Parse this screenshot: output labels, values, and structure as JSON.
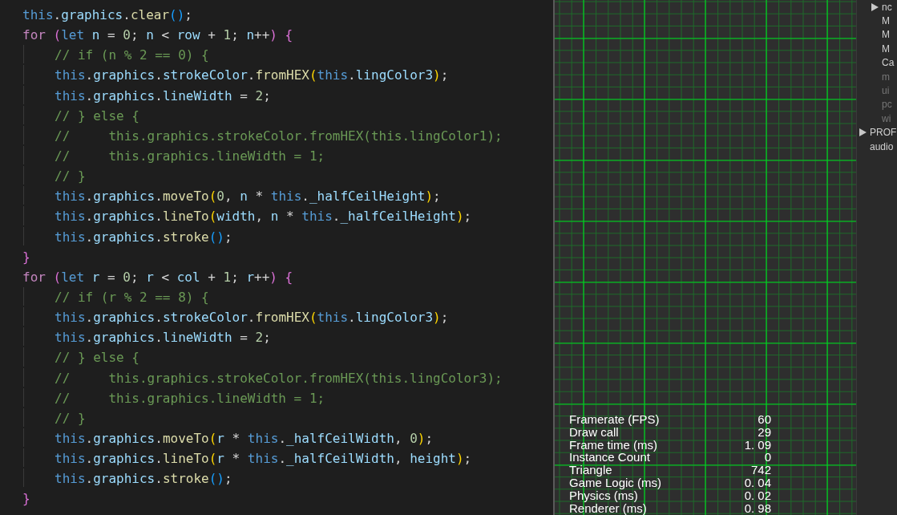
{
  "editor": {
    "lines": [
      {
        "tokens": [
          {
            "kind": "this",
            "text": "this"
          },
          {
            "kind": "punc",
            "text": "."
          },
          {
            "kind": "prop",
            "text": "graphics"
          },
          {
            "kind": "punc",
            "text": "."
          },
          {
            "kind": "fn",
            "text": "clear"
          },
          {
            "kind": "b3",
            "text": "()"
          },
          {
            "kind": "punc",
            "text": ";"
          }
        ]
      },
      {
        "tokens": [
          {
            "kind": "kw",
            "text": "for"
          },
          {
            "kind": "b1",
            "text": " ("
          },
          {
            "kind": "kw2",
            "text": "let"
          },
          {
            "kind": "prop",
            "text": " n"
          },
          {
            "kind": "punc",
            "text": " = "
          },
          {
            "kind": "num",
            "text": "0"
          },
          {
            "kind": "punc",
            "text": "; "
          },
          {
            "kind": "prop",
            "text": "n"
          },
          {
            "kind": "punc",
            "text": " < "
          },
          {
            "kind": "prop",
            "text": "row"
          },
          {
            "kind": "punc",
            "text": " + "
          },
          {
            "kind": "num",
            "text": "1"
          },
          {
            "kind": "punc",
            "text": "; "
          },
          {
            "kind": "prop",
            "text": "n"
          },
          {
            "kind": "punc",
            "text": "++"
          },
          {
            "kind": "b1",
            "text": ")"
          },
          {
            "kind": "b1",
            "text": " {"
          }
        ],
        "children": [
          {
            "tokens": [
              {
                "kind": "cmt",
                "text": "// if (n % 2 == 0) {"
              }
            ]
          },
          {
            "tokens": [
              {
                "kind": "this",
                "text": "this"
              },
              {
                "kind": "punc",
                "text": "."
              },
              {
                "kind": "prop",
                "text": "graphics"
              },
              {
                "kind": "punc",
                "text": "."
              },
              {
                "kind": "prop",
                "text": "strokeColor"
              },
              {
                "kind": "punc",
                "text": "."
              },
              {
                "kind": "fn",
                "text": "fromHEX"
              },
              {
                "kind": "b2",
                "text": "("
              },
              {
                "kind": "this",
                "text": "this"
              },
              {
                "kind": "punc",
                "text": "."
              },
              {
                "kind": "prop",
                "text": "lingColor3"
              },
              {
                "kind": "b2",
                "text": ")"
              },
              {
                "kind": "punc",
                "text": ";"
              }
            ]
          },
          {
            "tokens": [
              {
                "kind": "this",
                "text": "this"
              },
              {
                "kind": "punc",
                "text": "."
              },
              {
                "kind": "prop",
                "text": "graphics"
              },
              {
                "kind": "punc",
                "text": "."
              },
              {
                "kind": "prop",
                "text": "lineWidth"
              },
              {
                "kind": "punc",
                "text": " = "
              },
              {
                "kind": "num",
                "text": "2"
              },
              {
                "kind": "punc",
                "text": ";"
              }
            ]
          },
          {
            "tokens": [
              {
                "kind": "cmt",
                "text": "// } else {"
              }
            ]
          },
          {
            "tokens": [
              {
                "kind": "cmt",
                "text": "//     this.graphics.strokeColor.fromHEX(this.lingColor1);"
              }
            ]
          },
          {
            "tokens": [
              {
                "kind": "cmt",
                "text": "//     this.graphics.lineWidth = 1;"
              }
            ]
          },
          {
            "tokens": [
              {
                "kind": "cmt",
                "text": "// }"
              }
            ]
          },
          {
            "tokens": [
              {
                "kind": "this",
                "text": "this"
              },
              {
                "kind": "punc",
                "text": "."
              },
              {
                "kind": "prop",
                "text": "graphics"
              },
              {
                "kind": "punc",
                "text": "."
              },
              {
                "kind": "fn",
                "text": "moveTo"
              },
              {
                "kind": "b2",
                "text": "("
              },
              {
                "kind": "num",
                "text": "0"
              },
              {
                "kind": "punc",
                "text": ", "
              },
              {
                "kind": "prop",
                "text": "n"
              },
              {
                "kind": "punc",
                "text": " * "
              },
              {
                "kind": "this",
                "text": "this"
              },
              {
                "kind": "punc",
                "text": "."
              },
              {
                "kind": "prop",
                "text": "_halfCeilHeight"
              },
              {
                "kind": "b2",
                "text": ")"
              },
              {
                "kind": "punc",
                "text": ";"
              }
            ]
          },
          {
            "tokens": [
              {
                "kind": "this",
                "text": "this"
              },
              {
                "kind": "punc",
                "text": "."
              },
              {
                "kind": "prop",
                "text": "graphics"
              },
              {
                "kind": "punc",
                "text": "."
              },
              {
                "kind": "fn",
                "text": "lineTo"
              },
              {
                "kind": "b2",
                "text": "("
              },
              {
                "kind": "prop",
                "text": "width"
              },
              {
                "kind": "punc",
                "text": ", "
              },
              {
                "kind": "prop",
                "text": "n"
              },
              {
                "kind": "punc",
                "text": " * "
              },
              {
                "kind": "this",
                "text": "this"
              },
              {
                "kind": "punc",
                "text": "."
              },
              {
                "kind": "prop",
                "text": "_halfCeilHeight"
              },
              {
                "kind": "b2",
                "text": ")"
              },
              {
                "kind": "punc",
                "text": ";"
              }
            ]
          },
          {
            "tokens": [
              {
                "kind": "this",
                "text": "this"
              },
              {
                "kind": "punc",
                "text": "."
              },
              {
                "kind": "prop",
                "text": "graphics"
              },
              {
                "kind": "punc",
                "text": "."
              },
              {
                "kind": "fn",
                "text": "stroke"
              },
              {
                "kind": "b3",
                "text": "()"
              },
              {
                "kind": "punc",
                "text": ";"
              }
            ]
          }
        ]
      },
      {
        "tokens": [
          {
            "kind": "b1",
            "text": "}"
          }
        ]
      },
      {
        "tokens": [
          {
            "kind": "kw",
            "text": "for"
          },
          {
            "kind": "b1",
            "text": " ("
          },
          {
            "kind": "kw2",
            "text": "let"
          },
          {
            "kind": "prop",
            "text": " r"
          },
          {
            "kind": "punc",
            "text": " = "
          },
          {
            "kind": "num",
            "text": "0"
          },
          {
            "kind": "punc",
            "text": "; "
          },
          {
            "kind": "prop",
            "text": "r"
          },
          {
            "kind": "punc",
            "text": " < "
          },
          {
            "kind": "prop",
            "text": "col"
          },
          {
            "kind": "punc",
            "text": " + "
          },
          {
            "kind": "num",
            "text": "1"
          },
          {
            "kind": "punc",
            "text": "; "
          },
          {
            "kind": "prop",
            "text": "r"
          },
          {
            "kind": "punc",
            "text": "++"
          },
          {
            "kind": "b1",
            "text": ")"
          },
          {
            "kind": "b1",
            "text": " {"
          }
        ],
        "children": [
          {
            "tokens": [
              {
                "kind": "cmt",
                "text": "// if (r % 2 == 8) {"
              }
            ]
          },
          {
            "tokens": [
              {
                "kind": "this",
                "text": "this"
              },
              {
                "kind": "punc",
                "text": "."
              },
              {
                "kind": "prop",
                "text": "graphics"
              },
              {
                "kind": "punc",
                "text": "."
              },
              {
                "kind": "prop",
                "text": "strokeColor"
              },
              {
                "kind": "punc",
                "text": "."
              },
              {
                "kind": "fn",
                "text": "fromHEX"
              },
              {
                "kind": "b2",
                "text": "("
              },
              {
                "kind": "this",
                "text": "this"
              },
              {
                "kind": "punc",
                "text": "."
              },
              {
                "kind": "prop",
                "text": "lingColor3"
              },
              {
                "kind": "b2",
                "text": ")"
              },
              {
                "kind": "punc",
                "text": ";"
              }
            ]
          },
          {
            "tokens": [
              {
                "kind": "this",
                "text": "this"
              },
              {
                "kind": "punc",
                "text": "."
              },
              {
                "kind": "prop",
                "text": "graphics"
              },
              {
                "kind": "punc",
                "text": "."
              },
              {
                "kind": "prop",
                "text": "lineWidth"
              },
              {
                "kind": "punc",
                "text": " = "
              },
              {
                "kind": "num",
                "text": "2"
              },
              {
                "kind": "punc",
                "text": ";"
              }
            ]
          },
          {
            "tokens": [
              {
                "kind": "cmt",
                "text": "// } else {"
              }
            ]
          },
          {
            "tokens": [
              {
                "kind": "cmt",
                "text": "//     this.graphics.strokeColor.fromHEX(this.lingColor3);"
              }
            ]
          },
          {
            "tokens": [
              {
                "kind": "cmt",
                "text": "//     this.graphics.lineWidth = 1;"
              }
            ]
          },
          {
            "tokens": [
              {
                "kind": "cmt",
                "text": "// }"
              }
            ]
          },
          {
            "tokens": [
              {
                "kind": "this",
                "text": "this"
              },
              {
                "kind": "punc",
                "text": "."
              },
              {
                "kind": "prop",
                "text": "graphics"
              },
              {
                "kind": "punc",
                "text": "."
              },
              {
                "kind": "fn",
                "text": "moveTo"
              },
              {
                "kind": "b2",
                "text": "("
              },
              {
                "kind": "prop",
                "text": "r"
              },
              {
                "kind": "punc",
                "text": " * "
              },
              {
                "kind": "this",
                "text": "this"
              },
              {
                "kind": "punc",
                "text": "."
              },
              {
                "kind": "prop",
                "text": "_halfCeilWidth"
              },
              {
                "kind": "punc",
                "text": ", "
              },
              {
                "kind": "num",
                "text": "0"
              },
              {
                "kind": "b2",
                "text": ")"
              },
              {
                "kind": "punc",
                "text": ";"
              }
            ]
          },
          {
            "tokens": [
              {
                "kind": "this",
                "text": "this"
              },
              {
                "kind": "punc",
                "text": "."
              },
              {
                "kind": "prop",
                "text": "graphics"
              },
              {
                "kind": "punc",
                "text": "."
              },
              {
                "kind": "fn",
                "text": "lineTo"
              },
              {
                "kind": "b2",
                "text": "("
              },
              {
                "kind": "prop",
                "text": "r"
              },
              {
                "kind": "punc",
                "text": " * "
              },
              {
                "kind": "this",
                "text": "this"
              },
              {
                "kind": "punc",
                "text": "."
              },
              {
                "kind": "prop",
                "text": "_halfCeilWidth"
              },
              {
                "kind": "punc",
                "text": ", "
              },
              {
                "kind": "prop",
                "text": "height"
              },
              {
                "kind": "b2",
                "text": ")"
              },
              {
                "kind": "punc",
                "text": ";"
              }
            ]
          },
          {
            "tokens": [
              {
                "kind": "this",
                "text": "this"
              },
              {
                "kind": "punc",
                "text": "."
              },
              {
                "kind": "prop",
                "text": "graphics"
              },
              {
                "kind": "punc",
                "text": "."
              },
              {
                "kind": "fn",
                "text": "stroke"
              },
              {
                "kind": "b3",
                "text": "()"
              },
              {
                "kind": "punc",
                "text": ";"
              }
            ]
          }
        ]
      },
      {
        "tokens": [
          {
            "kind": "b1",
            "text": "}"
          }
        ]
      }
    ]
  },
  "stats": [
    {
      "label": "Framerate (FPS)",
      "value": "60"
    },
    {
      "label": "Draw call",
      "value": "29"
    },
    {
      "label": "Frame time (ms)",
      "value": "1. 09"
    },
    {
      "label": "Instance Count",
      "value": "0"
    },
    {
      "label": "Triangle",
      "value": "742"
    },
    {
      "label": "Game Logic (ms)",
      "value": "0. 04"
    },
    {
      "label": "Physics (ms)",
      "value": "0. 02"
    },
    {
      "label": "Renderer (ms)",
      "value": "0. 98"
    }
  ],
  "hierarchy": {
    "inner_items": [
      {
        "label": "nc",
        "kind": "group",
        "expanded": false,
        "active": true
      },
      {
        "label": "M",
        "kind": "leaf",
        "active": true
      },
      {
        "label": "M",
        "kind": "leaf",
        "active": true
      },
      {
        "label": "M",
        "kind": "leaf",
        "active": true
      },
      {
        "label": "Ca",
        "kind": "leaf",
        "active": true
      },
      {
        "label": "m",
        "kind": "leaf",
        "active": false
      },
      {
        "label": "ui",
        "kind": "leaf",
        "active": false
      },
      {
        "label": "pc",
        "kind": "leaf",
        "active": false
      },
      {
        "label": "wi",
        "kind": "leaf",
        "active": false
      }
    ],
    "items": [
      {
        "label": "PROF",
        "kind": "group",
        "expanded": false,
        "active": true
      },
      {
        "label": "audio",
        "kind": "leaf",
        "active": true
      }
    ]
  }
}
